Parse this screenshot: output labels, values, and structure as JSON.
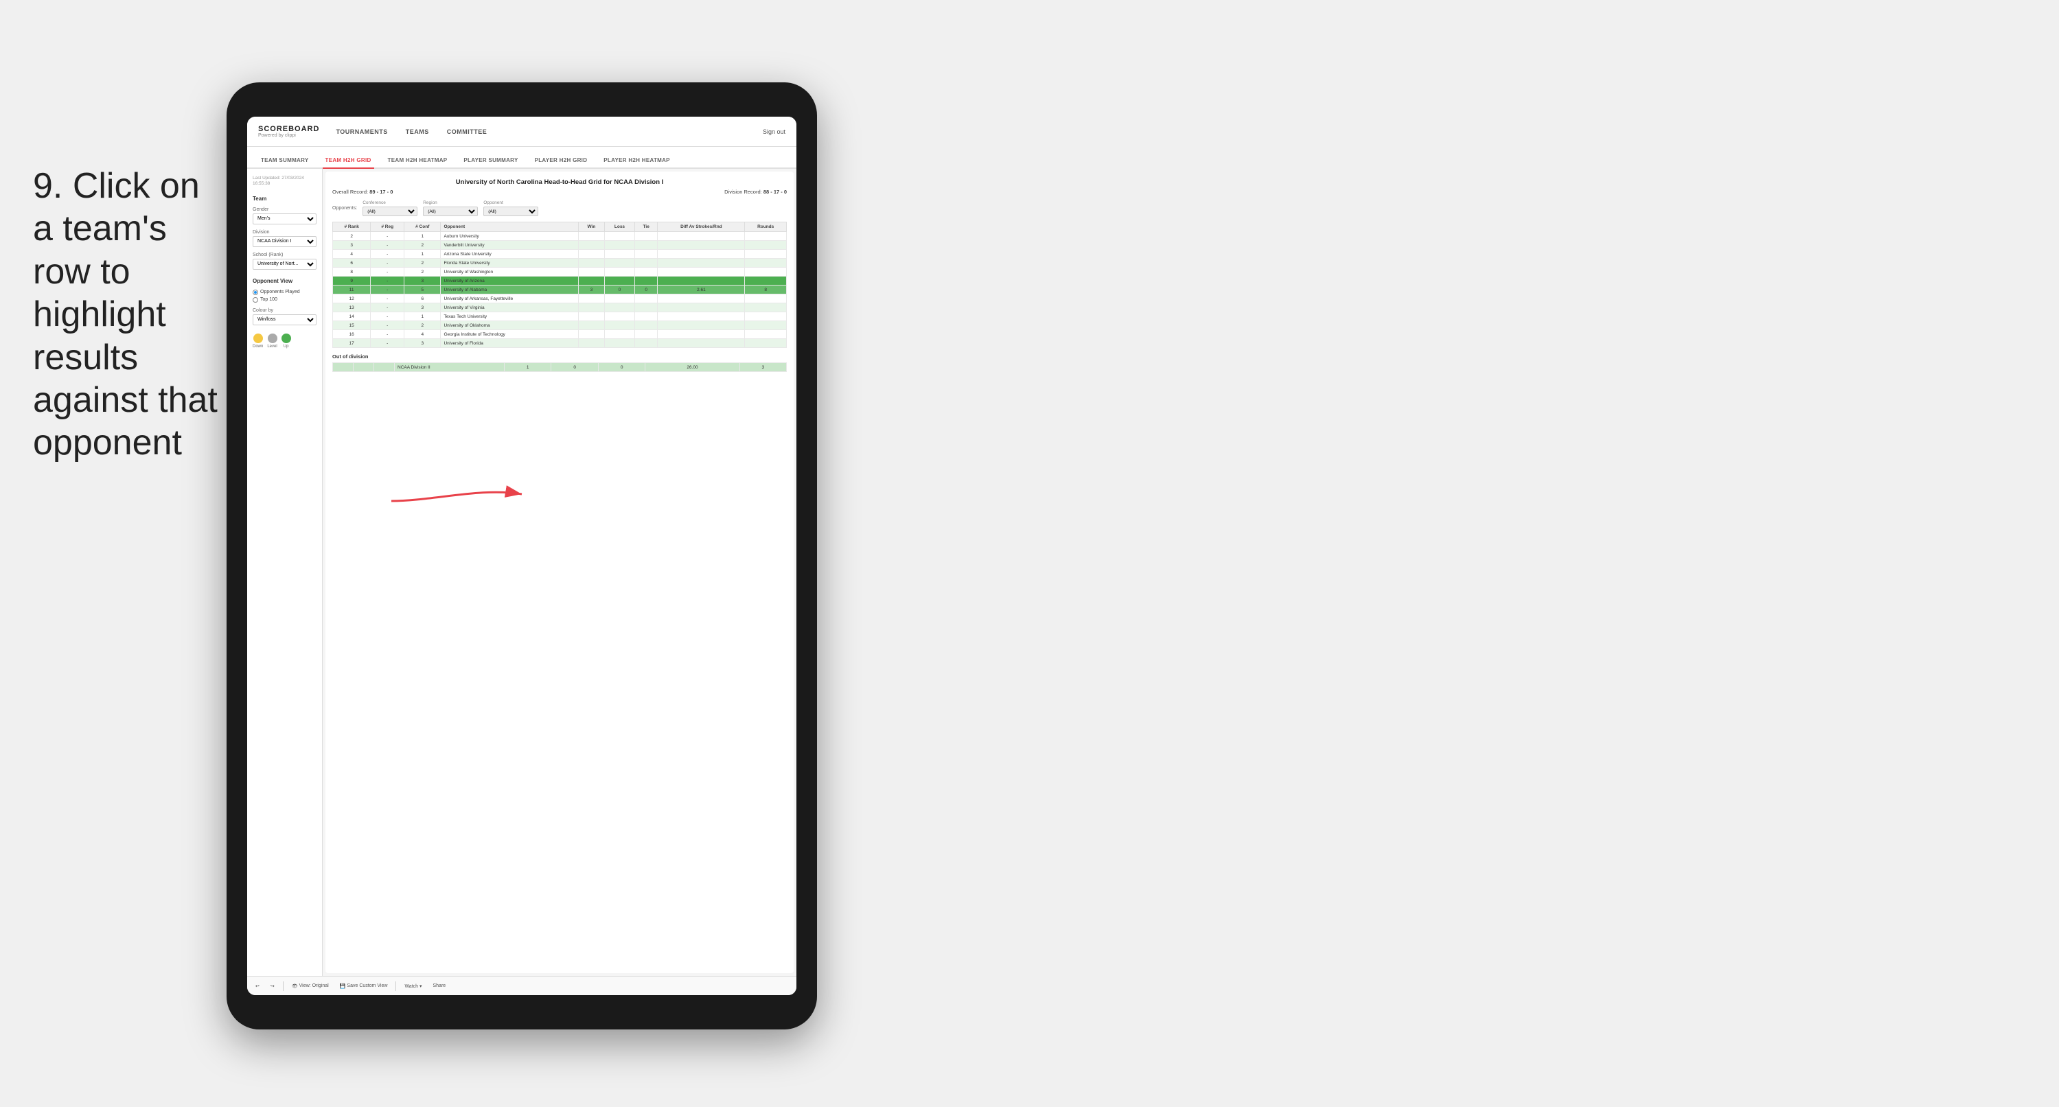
{
  "instruction": {
    "step": "9.",
    "text": "Click on a team's row to highlight results against that opponent"
  },
  "nav": {
    "logo": "SCOREBOARD",
    "logo_sub": "Powered by clippi",
    "items": [
      "TOURNAMENTS",
      "TEAMS",
      "COMMITTEE"
    ],
    "sign_out": "Sign out"
  },
  "sub_nav": {
    "items": [
      "TEAM SUMMARY",
      "TEAM H2H GRID",
      "TEAM H2H HEATMAP",
      "PLAYER SUMMARY",
      "PLAYER H2H GRID",
      "PLAYER H2H HEATMAP"
    ],
    "active": "TEAM H2H GRID"
  },
  "sidebar": {
    "timestamp_label": "Last Updated: 27/03/2024",
    "timestamp_time": "16:55:38",
    "team_label": "Team",
    "gender_label": "Gender",
    "gender_value": "Men's",
    "division_label": "Division",
    "division_value": "NCAA Division I",
    "school_label": "School (Rank)",
    "school_value": "University of Nort...",
    "opponent_view_label": "Opponent View",
    "opponent_played": "Opponents Played",
    "top_100": "Top 100",
    "colour_by_label": "Colour by",
    "colour_by_value": "Win/loss",
    "legend": {
      "down_label": "Down",
      "level_label": "Level",
      "up_label": "Up"
    }
  },
  "grid": {
    "title": "University of North Carolina Head-to-Head Grid for NCAA Division I",
    "overall_record_label": "Overall Record:",
    "overall_record": "89 - 17 - 0",
    "division_record_label": "Division Record:",
    "division_record": "88 - 17 - 0",
    "filter_conference_label": "Conference",
    "filter_conference_value": "(All)",
    "filter_region_label": "Region",
    "filter_region_value": "(All)",
    "filter_opponent_label": "Opponent",
    "filter_opponent_value": "(All)",
    "opponents_label": "Opponents:",
    "columns": {
      "rank": "# Rank",
      "reg": "# Reg",
      "conf": "# Conf",
      "opponent": "Opponent",
      "win": "Win",
      "loss": "Loss",
      "tie": "Tie",
      "diff_av": "Diff Av Strokes/Rnd",
      "rounds": "Rounds"
    },
    "rows": [
      {
        "rank": "2",
        "reg": "-",
        "conf": "1",
        "opponent": "Auburn University",
        "win": "",
        "loss": "",
        "tie": "",
        "diff": "",
        "rounds": "",
        "style": "normal"
      },
      {
        "rank": "3",
        "reg": "-",
        "conf": "2",
        "opponent": "Vanderbilt University",
        "win": "",
        "loss": "",
        "tie": "",
        "diff": "",
        "rounds": "",
        "style": "light-green"
      },
      {
        "rank": "4",
        "reg": "-",
        "conf": "1",
        "opponent": "Arizona State University",
        "win": "",
        "loss": "",
        "tie": "",
        "diff": "",
        "rounds": "",
        "style": "normal"
      },
      {
        "rank": "6",
        "reg": "-",
        "conf": "2",
        "opponent": "Florida State University",
        "win": "",
        "loss": "",
        "tie": "",
        "diff": "",
        "rounds": "",
        "style": "light-green"
      },
      {
        "rank": "8",
        "reg": "-",
        "conf": "2",
        "opponent": "University of Washington",
        "win": "",
        "loss": "",
        "tie": "",
        "diff": "",
        "rounds": "",
        "style": "normal"
      },
      {
        "rank": "9",
        "reg": "-",
        "conf": "3",
        "opponent": "University of Arizona",
        "win": "",
        "loss": "",
        "tie": "",
        "diff": "",
        "rounds": "",
        "style": "highlighted"
      },
      {
        "rank": "11",
        "reg": "-",
        "conf": "5",
        "opponent": "University of Alabama",
        "win": "3",
        "loss": "0",
        "tie": "0",
        "diff": "2.61",
        "rounds": "8",
        "style": "selected"
      },
      {
        "rank": "12",
        "reg": "-",
        "conf": "6",
        "opponent": "University of Arkansas, Fayetteville",
        "win": "",
        "loss": "",
        "tie": "",
        "diff": "",
        "rounds": "",
        "style": "normal"
      },
      {
        "rank": "13",
        "reg": "-",
        "conf": "3",
        "opponent": "University of Virginia",
        "win": "",
        "loss": "",
        "tie": "",
        "diff": "",
        "rounds": "",
        "style": "light-green"
      },
      {
        "rank": "14",
        "reg": "-",
        "conf": "1",
        "opponent": "Texas Tech University",
        "win": "",
        "loss": "",
        "tie": "",
        "diff": "",
        "rounds": "",
        "style": "normal"
      },
      {
        "rank": "15",
        "reg": "-",
        "conf": "2",
        "opponent": "University of Oklahoma",
        "win": "",
        "loss": "",
        "tie": "",
        "diff": "",
        "rounds": "",
        "style": "light-green"
      },
      {
        "rank": "16",
        "reg": "-",
        "conf": "4",
        "opponent": "Georgia Institute of Technology",
        "win": "",
        "loss": "",
        "tie": "",
        "diff": "",
        "rounds": "",
        "style": "normal"
      },
      {
        "rank": "17",
        "reg": "-",
        "conf": "3",
        "opponent": "University of Florida",
        "win": "",
        "loss": "",
        "tie": "",
        "diff": "",
        "rounds": "",
        "style": "light-green"
      }
    ],
    "out_of_division_label": "Out of division",
    "out_of_division_row": {
      "division": "NCAA Division II",
      "win": "1",
      "loss": "0",
      "tie": "0",
      "diff": "26.00",
      "rounds": "3"
    }
  },
  "toolbar": {
    "undo": "↩",
    "redo": "↪",
    "view_original": "View: Original",
    "save_custom": "Save Custom View",
    "watch": "Watch ▾",
    "share": "Share"
  }
}
